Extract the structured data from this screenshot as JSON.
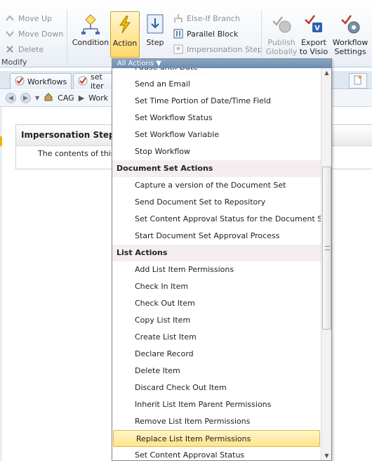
{
  "ribbon": {
    "modify_group": {
      "label": "Modify",
      "move_up": "Move Up",
      "move_down": "Move Down",
      "delete": "Delete"
    },
    "condition": "Condition",
    "action": "Action",
    "step": "Step",
    "else_if_branch": "Else-If Branch",
    "parallel_block": "Parallel Block",
    "impersonation_step": "Impersonation Step",
    "publish_globally": [
      "Publish",
      "Globally"
    ],
    "export_to_visio": [
      "Export",
      "to Visio"
    ],
    "workflow_settings": [
      "Workflow",
      "Settings"
    ]
  },
  "tabs": [
    {
      "label": "Workflows"
    },
    {
      "label": "set iter"
    }
  ],
  "breadcrumb": {
    "root": "CAG",
    "next": "Work"
  },
  "step_card": {
    "title": "Impersonation Step",
    "body": "The contents of this"
  },
  "dropdown": {
    "header": "All Actions ▼",
    "rows": [
      {
        "type": "item",
        "label": "Pause until Date"
      },
      {
        "type": "item",
        "label": "Send an Email"
      },
      {
        "type": "item",
        "label": "Set Time Portion of Date/Time Field"
      },
      {
        "type": "item",
        "label": "Set Workflow Status"
      },
      {
        "type": "item",
        "label": "Set Workflow Variable"
      },
      {
        "type": "item",
        "label": "Stop Workflow"
      },
      {
        "type": "category",
        "label": "Document Set Actions"
      },
      {
        "type": "item",
        "label": "Capture a version of the Document Set"
      },
      {
        "type": "item",
        "label": "Send Document Set to Repository"
      },
      {
        "type": "item",
        "label": "Set Content Approval Status for the Document Set"
      },
      {
        "type": "item",
        "label": "Start Document Set Approval Process"
      },
      {
        "type": "category",
        "label": "List Actions"
      },
      {
        "type": "item",
        "label": "Add List Item Permissions"
      },
      {
        "type": "item",
        "label": "Check In Item"
      },
      {
        "type": "item",
        "label": "Check Out Item"
      },
      {
        "type": "item",
        "label": "Copy List Item"
      },
      {
        "type": "item",
        "label": "Create List Item"
      },
      {
        "type": "item",
        "label": "Declare Record"
      },
      {
        "type": "item",
        "label": "Delete Item"
      },
      {
        "type": "item",
        "label": "Discard Check Out Item"
      },
      {
        "type": "item",
        "label": "Inherit List Item Parent Permissions"
      },
      {
        "type": "item",
        "label": "Remove List Item Permissions"
      },
      {
        "type": "item",
        "label": "Replace List Item Permissions",
        "selected": true
      },
      {
        "type": "item",
        "label": "Set Content Approval Status"
      }
    ]
  },
  "colors": {
    "selection": "#ffe48a",
    "category_bg": "#f5eef1",
    "header_bg": "#6c8bb0"
  }
}
